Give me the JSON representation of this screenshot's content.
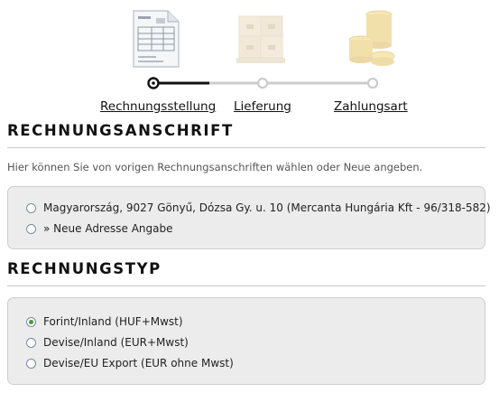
{
  "steps": [
    {
      "label": "Rechnungsstellung",
      "state": "current",
      "icon": "invoice-document-icon"
    },
    {
      "label": "Lieferung",
      "state": "pending",
      "icon": "pallet-boxes-icon"
    },
    {
      "label": "Zahlungsart",
      "state": "pending",
      "icon": "coin-stack-icon"
    }
  ],
  "invoice_address": {
    "title": "RECHNUNGSANSCHRIFT",
    "hint": "Hier können Sie von vorigen Rechnungsanschriften wählen oder Neue angeben.",
    "options": [
      {
        "label": "Magyarország, 9027 Gönyű, Dózsa Gy. u. 10 (Mercanta Hungária Kft - 96/318-582)",
        "selected": false
      },
      {
        "label": "» Neue Adresse Angabe",
        "selected": false
      }
    ]
  },
  "invoice_type": {
    "title": "RECHNUNGSTYP",
    "options": [
      {
        "label": "Forint/Inland (HUF+Mwst)",
        "selected": true
      },
      {
        "label": "Devise/Inland (EUR+Mwst)",
        "selected": false
      },
      {
        "label": "Devise/EU Export (EUR ohne Mwst)",
        "selected": false
      }
    ]
  },
  "colors": {
    "selected_radio": "#3f9c3f",
    "box_background": "#ececec",
    "track_active": "#111111",
    "track_pending": "#cccccc"
  }
}
